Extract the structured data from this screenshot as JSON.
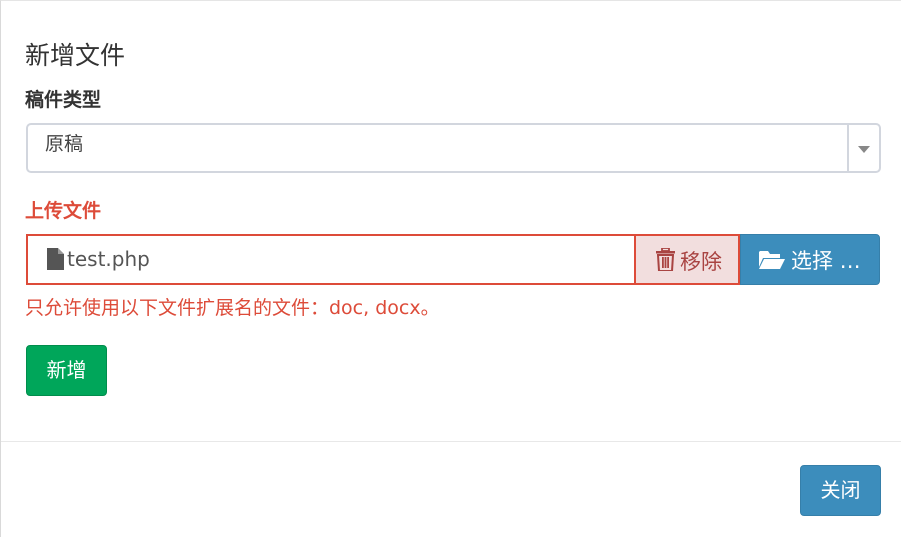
{
  "modal": {
    "title": "新增文件"
  },
  "form": {
    "type_label": "稿件类型",
    "type_select": {
      "selected": "原稿"
    },
    "upload_label": "上传文件",
    "file": {
      "name": "test.php",
      "remove_label": "移除",
      "choose_label": "选择 …"
    },
    "help_text": "只允许使用以下文件扩展名的文件：doc, docx。",
    "add_label": "新增"
  },
  "footer": {
    "close_label": "关闭"
  },
  "colors": {
    "primary": "#3c8dbc",
    "success": "#00a65a",
    "danger": "#dd4b39",
    "danger_bg": "#f2dede"
  },
  "icons": {
    "file": "file-icon",
    "trash": "trash-icon",
    "folder": "folder-open-icon",
    "dropdown": "chevron-down-icon"
  }
}
